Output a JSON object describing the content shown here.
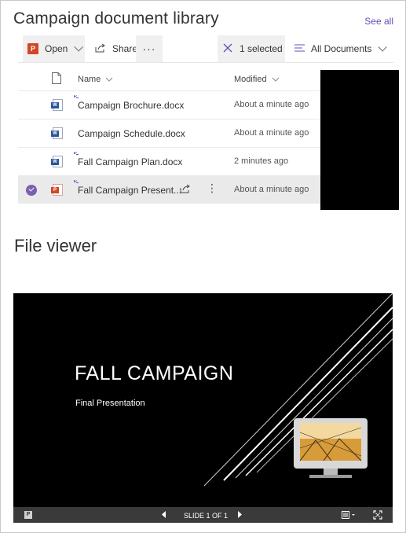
{
  "library": {
    "title": "Campaign document library",
    "see_all": "See all",
    "toolbar": {
      "open_label": "Open",
      "share_label": "Share",
      "more_label": "···",
      "selected_label": "1 selected",
      "view_label": "All Documents"
    },
    "columns": {
      "name": "Name",
      "modified": "Modified"
    },
    "rows": [
      {
        "name": "Campaign Brochure.docx",
        "modified": "About a minute ago",
        "type": "word",
        "new": true,
        "selected": false
      },
      {
        "name": "Campaign Schedule.docx",
        "modified": "About a minute ago",
        "type": "word",
        "new": false,
        "selected": false
      },
      {
        "name": "Fall Campaign Plan.docx",
        "modified": "2 minutes ago",
        "type": "word",
        "new": true,
        "selected": false
      },
      {
        "name": "Fall Campaign Present...",
        "modified": "About a minute ago",
        "type": "powerpoint",
        "new": true,
        "selected": true
      }
    ]
  },
  "viewer": {
    "title": "File viewer",
    "slide": {
      "title": "FALL CAMPAIGN",
      "subtitle": "Final Presentation"
    },
    "bar": {
      "slide_indicator": "SLIDE 1 OF 1"
    }
  },
  "colors": {
    "accent": "#6b49b8",
    "powerpoint": "#d24726",
    "word": "#2b579a"
  }
}
